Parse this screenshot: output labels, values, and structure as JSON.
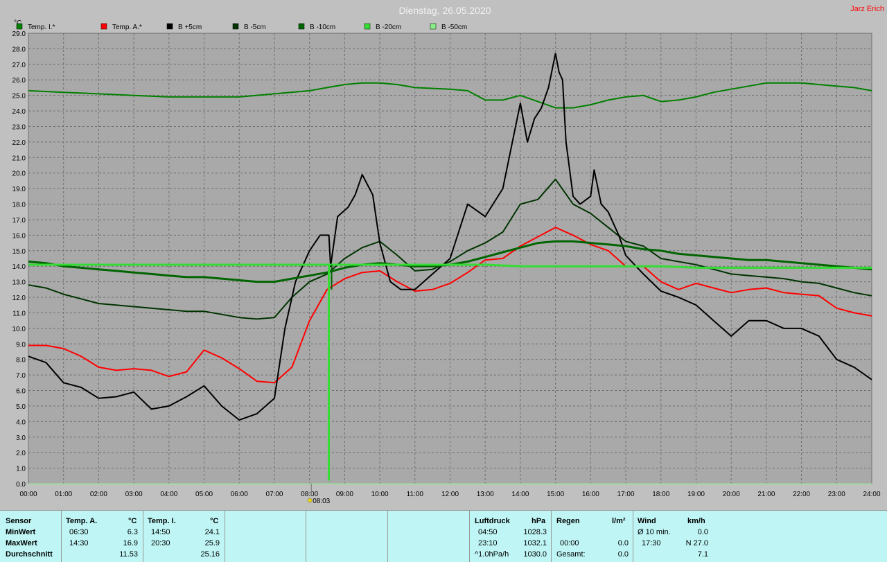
{
  "chart_data": {
    "type": "line",
    "title": "Dienstag, 26.05.2020",
    "author": "Jarz Erich",
    "yunit": "°C",
    "ylim": [
      0,
      29
    ],
    "ytick_step": 1,
    "xlim": [
      0,
      24
    ],
    "xtick_labels": [
      "00:00",
      "01:00",
      "02:00",
      "03:00",
      "04:00",
      "05:00",
      "06:00",
      "07:00",
      "08:00",
      "09:00",
      "10:00",
      "11:00",
      "12:00",
      "13:00",
      "14:00",
      "15:00",
      "16:00",
      "17:00",
      "18:00",
      "19:00",
      "20:00",
      "21:00",
      "22:00",
      "23:00",
      "24:00"
    ],
    "marker_label": "08:03",
    "marker_x": 8.05,
    "grid": true,
    "legend_position": "top",
    "series": [
      {
        "name": "Temp. I.*",
        "color": "#008000",
        "width": 2,
        "x": [
          0,
          1,
          2,
          3,
          4,
          5,
          6,
          7,
          8,
          8.5,
          9,
          9.5,
          10,
          10.5,
          11,
          12,
          12.5,
          13,
          13.5,
          14,
          14.5,
          15,
          15.5,
          16,
          16.5,
          17,
          17.5,
          18,
          18.5,
          19,
          19.5,
          20,
          20.5,
          21,
          21.5,
          22,
          22.5,
          23,
          23.5,
          24
        ],
        "y": [
          25.3,
          25.2,
          25.1,
          25.0,
          24.9,
          24.9,
          24.9,
          25.1,
          25.3,
          25.5,
          25.7,
          25.8,
          25.8,
          25.7,
          25.5,
          25.4,
          25.3,
          24.7,
          24.7,
          25.0,
          24.6,
          24.2,
          24.2,
          24.4,
          24.7,
          24.9,
          25.0,
          24.6,
          24.7,
          24.9,
          25.2,
          25.4,
          25.6,
          25.8,
          25.8,
          25.8,
          25.7,
          25.6,
          25.5,
          25.3
        ]
      },
      {
        "name": "Temp. A.*",
        "color": "#ff0000",
        "width": 2,
        "x": [
          0,
          0.5,
          1,
          1.5,
          2,
          2.5,
          3,
          3.5,
          4,
          4.5,
          5,
          5.5,
          6,
          6.5,
          7,
          7.5,
          8,
          8.5,
          9,
          9.5,
          10,
          10.5,
          11,
          11.5,
          12,
          12.5,
          13,
          13.5,
          14,
          14.5,
          15,
          15.5,
          16,
          16.5,
          17,
          17.5,
          18,
          18.5,
          19,
          19.5,
          20,
          20.5,
          21,
          21.5,
          22,
          22.5,
          23,
          23.5,
          24
        ],
        "y": [
          8.9,
          8.9,
          8.7,
          8.2,
          7.5,
          7.3,
          7.4,
          7.3,
          6.9,
          7.2,
          8.6,
          8.1,
          7.4,
          6.6,
          6.5,
          7.5,
          10.5,
          12.5,
          13.2,
          13.6,
          13.7,
          13.0,
          12.4,
          12.5,
          12.9,
          13.6,
          14.4,
          14.5,
          15.3,
          15.9,
          16.5,
          16.0,
          15.4,
          15.0,
          14.0,
          14.0,
          13.0,
          12.5,
          12.9,
          12.6,
          12.3,
          12.5,
          12.6,
          12.3,
          12.2,
          12.1,
          11.3,
          11.0,
          10.8
        ]
      },
      {
        "name": "B +5cm",
        "color": "#000000",
        "width": 2,
        "x": [
          0,
          0.5,
          1,
          1.5,
          2,
          2.5,
          3,
          3.5,
          4,
          4.5,
          5,
          5.5,
          6,
          6.5,
          7,
          7.3,
          7.6,
          8,
          8.3,
          8.55,
          8.6,
          8.8,
          9.1,
          9.3,
          9.5,
          9.8,
          10,
          10.3,
          10.6,
          11,
          11.5,
          12,
          12.5,
          13,
          13.5,
          14,
          14.2,
          14.4,
          14.6,
          14.8,
          15,
          15.1,
          15.2,
          15.3,
          15.5,
          15.7,
          16,
          16.1,
          16.3,
          16.5,
          16.8,
          17,
          17.5,
          18,
          18.5,
          19,
          19.5,
          20,
          20.5,
          21,
          21.5,
          22,
          22.5,
          23,
          23.5,
          24
        ],
        "y": [
          8.2,
          7.8,
          6.5,
          6.2,
          5.5,
          5.6,
          5.9,
          4.8,
          5.0,
          5.6,
          6.3,
          5.0,
          4.1,
          4.5,
          5.5,
          10.0,
          13.0,
          15.0,
          16.0,
          16.0,
          14.0,
          17.2,
          17.8,
          18.6,
          19.9,
          18.6,
          15.5,
          13.0,
          12.5,
          12.5,
          13.5,
          14.5,
          18.0,
          17.2,
          19.0,
          24.5,
          22.0,
          23.5,
          24.2,
          25.5,
          27.7,
          26.5,
          26.0,
          22.0,
          18.5,
          18.0,
          18.5,
          20.2,
          18.0,
          17.5,
          16.0,
          14.7,
          13.5,
          12.4,
          12.0,
          11.5,
          10.5,
          9.5,
          10.5,
          10.5,
          10.0,
          10.0,
          9.5,
          8.0,
          7.5,
          6.7
        ]
      },
      {
        "name": "B -5cm",
        "color": "#003300",
        "width": 2,
        "x": [
          0,
          0.5,
          1,
          1.5,
          2,
          2.5,
          3,
          3.5,
          4,
          4.5,
          5,
          5.5,
          6,
          6.5,
          7,
          7.5,
          8,
          8.5,
          9,
          9.5,
          10,
          10.5,
          11,
          11.5,
          12,
          12.5,
          13,
          13.5,
          14,
          14.5,
          15,
          15.5,
          16,
          16.5,
          17,
          17.5,
          18,
          18.5,
          19,
          19.5,
          20,
          20.5,
          21,
          21.5,
          22,
          22.5,
          23,
          23.5,
          24
        ],
        "y": [
          12.8,
          12.6,
          12.2,
          11.9,
          11.6,
          11.5,
          11.4,
          11.3,
          11.2,
          11.1,
          11.1,
          10.9,
          10.7,
          10.6,
          10.7,
          12.0,
          13.0,
          13.5,
          14.5,
          15.2,
          15.6,
          14.7,
          13.7,
          13.8,
          14.3,
          15.0,
          15.5,
          16.2,
          18.0,
          18.3,
          19.6,
          18.0,
          17.4,
          16.5,
          15.6,
          15.3,
          14.5,
          14.3,
          14.1,
          13.8,
          13.5,
          13.4,
          13.3,
          13.2,
          13.0,
          12.9,
          12.6,
          12.3,
          12.1
        ]
      },
      {
        "name": "B -10cm",
        "color": "#006400",
        "width": 3,
        "x": [
          0,
          0.5,
          1,
          1.5,
          2,
          2.5,
          3,
          3.5,
          4,
          4.5,
          5,
          5.5,
          6,
          6.5,
          7,
          7.5,
          8,
          8.5,
          9,
          9.5,
          10,
          10.5,
          11,
          11.5,
          12,
          12.5,
          13,
          13.5,
          14,
          14.5,
          15,
          15.5,
          16,
          16.5,
          17,
          17.5,
          18,
          18.5,
          19,
          19.5,
          20,
          20.5,
          21,
          21.5,
          22,
          22.5,
          23,
          23.5,
          24
        ],
        "y": [
          14.3,
          14.2,
          14.0,
          13.9,
          13.8,
          13.7,
          13.6,
          13.5,
          13.4,
          13.3,
          13.3,
          13.2,
          13.1,
          13.0,
          13.0,
          13.2,
          13.4,
          13.6,
          13.9,
          14.1,
          14.2,
          14.1,
          14.0,
          14.0,
          14.1,
          14.3,
          14.6,
          14.9,
          15.2,
          15.5,
          15.6,
          15.6,
          15.5,
          15.4,
          15.3,
          15.1,
          15.0,
          14.8,
          14.7,
          14.6,
          14.5,
          14.4,
          14.4,
          14.3,
          14.2,
          14.1,
          14.0,
          13.9,
          13.8
        ]
      },
      {
        "name": "B -20cm",
        "color": "#33dd33",
        "width": 3,
        "x": [
          0,
          2,
          4,
          6,
          8,
          8.5,
          8.6,
          9,
          10,
          11,
          12,
          13,
          14,
          15,
          16,
          17,
          18,
          19,
          20,
          21,
          22,
          23,
          24
        ],
        "y": [
          14.1,
          14.1,
          14.1,
          14.1,
          14.1,
          14.1,
          14.1,
          14.1,
          14.1,
          14.1,
          14.1,
          14.1,
          14.0,
          14.0,
          14.0,
          14.0,
          14.0,
          13.9,
          13.9,
          13.9,
          13.9,
          13.9,
          13.9
        ]
      },
      {
        "name": "B -50cm",
        "color": "#88ee88",
        "width": 1,
        "x": [
          0,
          24
        ],
        "y": [
          0,
          0
        ]
      }
    ],
    "spike_x": 8.55,
    "spike_bottom": 0.2
  },
  "footer": {
    "sensor": {
      "header": "Sensor",
      "min": "MinWert",
      "max": "MaxWert",
      "avg": "Durchschnitt"
    },
    "temp_a": {
      "header": "Temp. A.",
      "unit": "°C",
      "min_time": "06:30",
      "min_val": "6.3",
      "max_time": "14:30",
      "max_val": "16.9",
      "avg": "11.53"
    },
    "temp_i": {
      "header": "Temp. I.",
      "unit": "°C",
      "min_time": "14:50",
      "min_val": "24.1",
      "max_time": "20:30",
      "max_val": "25.9",
      "avg": "25.16"
    },
    "pressure": {
      "header": "Luftdruck",
      "unit": "hPa",
      "min_time": "04:50",
      "min_val": "1028.3",
      "max_time": "23:10",
      "max_val": "1032.1",
      "avg_label": "^1.0hPa/h",
      "avg": "1030.0"
    },
    "rain": {
      "header": "Regen",
      "unit": "l/m²",
      "max_time": "00:00",
      "max_val": "0.0",
      "total_label": "Gesamt:",
      "total": "0.0"
    },
    "wind": {
      "header": "Wind",
      "unit": "km/h",
      "min_label": "Ø 10 min.",
      "min_val": "0.0",
      "max_time": "17:30",
      "max_val": "N 27.0",
      "avg": "7.1"
    }
  }
}
